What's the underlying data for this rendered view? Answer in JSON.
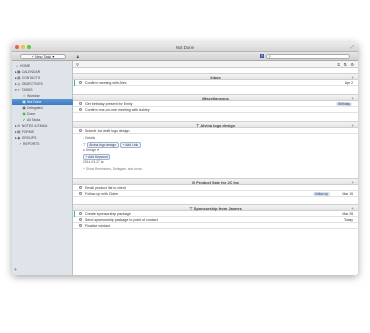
{
  "window": {
    "title": "Not Done"
  },
  "toolbar": {
    "new_task": "+ New Task",
    "dropdown": "▾",
    "person_icon": "person-icon",
    "fb": "f",
    "search_placeholder": ""
  },
  "sidebar": {
    "items": [
      {
        "label": "HOME",
        "icon": "⌂"
      },
      {
        "label": "CALENDAR",
        "icon": "▦"
      },
      {
        "label": "CONTACTS",
        "icon": "▤"
      },
      {
        "label": "OBJECTIVES",
        "icon": "◎"
      },
      {
        "label": "TASKS",
        "icon": "✔"
      },
      {
        "label": "Workbar",
        "icon": "★"
      },
      {
        "label": "Not Done",
        "icon": "▣"
      },
      {
        "label": "Delegated",
        "icon": "▣"
      },
      {
        "label": "Done",
        "icon": "▣"
      },
      {
        "label": "All Tasks",
        "icon": "✔"
      },
      {
        "label": "NOTES & EMAIL",
        "icon": "✉"
      },
      {
        "label": "FORMS",
        "icon": "▤"
      },
      {
        "label": "GROUPS",
        "icon": "◉"
      },
      {
        "label": "REPORTS",
        "icon": "◔"
      }
    ],
    "add": "+"
  },
  "subbar": {
    "filter": "⧖",
    "sort": "⇅",
    "gear": "⚙",
    "q": "Q"
  },
  "sections": {
    "inbox": "Inbox",
    "misc": "Miscellaneous",
    "alvina": "Alvina logo design",
    "product": "Product Sale for JC Inc",
    "sponsorship": "Sponsorship from Jannes"
  },
  "tasks": {
    "confirm_alex": {
      "text": "Confirm meeting with Alex",
      "date": "Apr 2"
    },
    "birthday": {
      "text": "Get birthday present for Emily",
      "tag": "Birthday"
    },
    "ashley": {
      "text": "Confirm one-on-one meeting with Ashley"
    },
    "submit_draft": {
      "text": "Submit 1st draft logo design"
    },
    "email_client": {
      "text": "Email product list to client"
    },
    "follow_claire": {
      "text": "Follow up with Claire",
      "tag": "follow up",
      "date": "Mar 15"
    },
    "sponsorship_pkg": {
      "text": "Create sponsorship package",
      "date": "Mar 28"
    },
    "send_pkg": {
      "text": "Send sponsorship package to point of contact",
      "date": "Today"
    },
    "finalize": {
      "text": "Finalize contact"
    }
  },
  "detail": {
    "details": "Details",
    "project": "Alvina logo design",
    "add_link": "+ Add Link",
    "category": "Design",
    "add_keyword": "+ Add Keyword",
    "date": "2014-03-27",
    "more": "+ Show Reminders, Delegate, and more..."
  }
}
